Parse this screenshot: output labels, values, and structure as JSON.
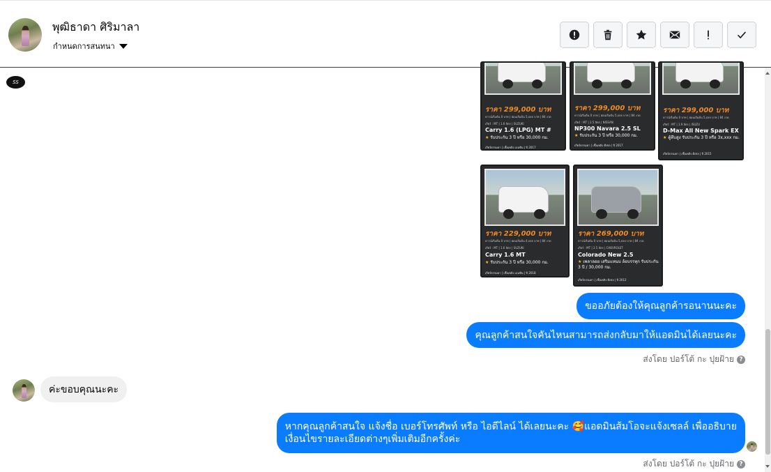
{
  "header": {
    "contact_name": "พุฒิธาดา ศิริมาลา",
    "conversation_settings": "กำหนดการสนทนา",
    "actions": [
      {
        "name": "report-button",
        "icon": "alert-circle-icon",
        "glyph": "!"
      },
      {
        "name": "delete-button",
        "icon": "trash-icon",
        "glyph": ""
      },
      {
        "name": "star-button",
        "icon": "star-icon",
        "glyph": "★"
      },
      {
        "name": "mark-unread-button",
        "icon": "envelope-icon",
        "glyph": "✉"
      },
      {
        "name": "mark-important-button",
        "icon": "exclamation-icon",
        "glyph": "!"
      },
      {
        "name": "mark-done-button",
        "icon": "check-icon",
        "glyph": "✓"
      }
    ]
  },
  "page_logo": "SS",
  "cards": [
    {
      "price": "ราคา 299,000 บาท",
      "details": "ดาวน์เริ่มต้น 0 บาท | ผ่อนเริ่มต้น 5,xxx บาท | 84 งวด",
      "specs": "เกียร์ : MT | 1.6 ลิตร | SUZUKI",
      "model": "Carry 1.6 (LPG) MT #",
      "warranty": "รับประกัน 3 ปี หรือ 30,000 กม.",
      "footer": "เกียร์ธรรมดา | เชื้อเพลิง เบนซิน | ปี 2017"
    },
    {
      "price": "ราคา 299,000 บาท",
      "details": "ดาวน์เริ่มต้น 0 บาท | ผ่อนเริ่มต้น 5,xxx บาท | 84 งวด",
      "specs": "เกียร์ : MT | 2.5 ลิตร | NISSAN",
      "model": "NP300 Navara 2.5 SL",
      "warranty": "รับประกัน 3 ปี หรือ 30,000 กม.",
      "footer": "เกียร์ธรรมดา | เชื้อเพลิง ดีเซล | ปี 2017"
    },
    {
      "price": "ราคา 299,000 บาท",
      "details": "ดาวน์เริ่มต้น 0 บาท | ผ่อนเริ่มต้น 5,xxx บาท | 84 งวด",
      "specs": "เกียร์ : MT | 1.9 ลิตร | ISUZU",
      "model": "D-Max All New Spark EX",
      "warranty": "ตู้ทึบสูง รับประกัน 3 ปี หรือ 3x,xxx กม.",
      "footer": "เกียร์ธรรมดา | เชื้อเพลิง ดีเซล | ปี 2015"
    },
    {
      "price": "ราคา 229,000 บาท",
      "details": "ดาวน์เริ่มต้น 0 บาท | ผ่อนเริ่มต้น 4,xxx บาท | 84 งวด",
      "specs": "เกียร์ : MT | 1.6 ลิตร | SUZUKI",
      "model": "Carry 1.6 MT",
      "warranty": "รับประกัน 3 ปี หรือ 30,000 กม.",
      "footer": "เกียร์ธรรมดา | เชื้อเพลิง เบนซิน | ปี 2018"
    },
    {
      "price": "ราคา 269,000 บาท",
      "details": "ดาวน์เริ่มต้น 0 บาท | ผ่อนเริ่มต้น 5,xxx บาท | 84 งวด",
      "specs": "เกียร์ : MT | 2.5 ลิตร | CHEVROLET",
      "model": "Colorado New 2.5",
      "warranty": "เพลาลอย เสริมแหนบ ล้อบรรทุก รับประกัน 3 ปี / 30,000 กม.",
      "footer": "เกียร์ธรรมดา | เชื้อเพลิง ดีเซล | ปี 2012"
    }
  ],
  "messages": {
    "out1": "ขออภัยต้องให้คุณลูกค้ารอนานนะคะ",
    "out2": "คุณลูกค้าสนใจคันไหนสามารถส่งกลับมาให้แอดมินได้เลยนะคะ",
    "sent_by_1": "ส่งโดย ปอร์โต้ กะ ปุยฝ้าย",
    "in1": "ค่ะขอบคุณนะคะ",
    "out3_line1": "หากคุณลูกค้าสนใจ แจ้งชื่อ เบอร์โทรศัพท์ หรือ ไอดีไลน์  ได้เลยนะคะ 🥰แอดมินส้มโอจะแจ้งเซลล์   เพื่ออธิบาย",
    "out3_line2": "เงื่อนไขรายละเอียดต่างๆเพิ่มเติมอีกครั้งค่ะ",
    "sent_by_2": "ส่งโดย ปอร์โต้ กะ ปุยฝ้าย",
    "info_glyph": "?"
  },
  "colors": {
    "outgoing_bubble": "#0a7cff",
    "incoming_bubble": "#f0f0f0",
    "price": "#f08a25",
    "card_bg": "#2a2b2d"
  }
}
